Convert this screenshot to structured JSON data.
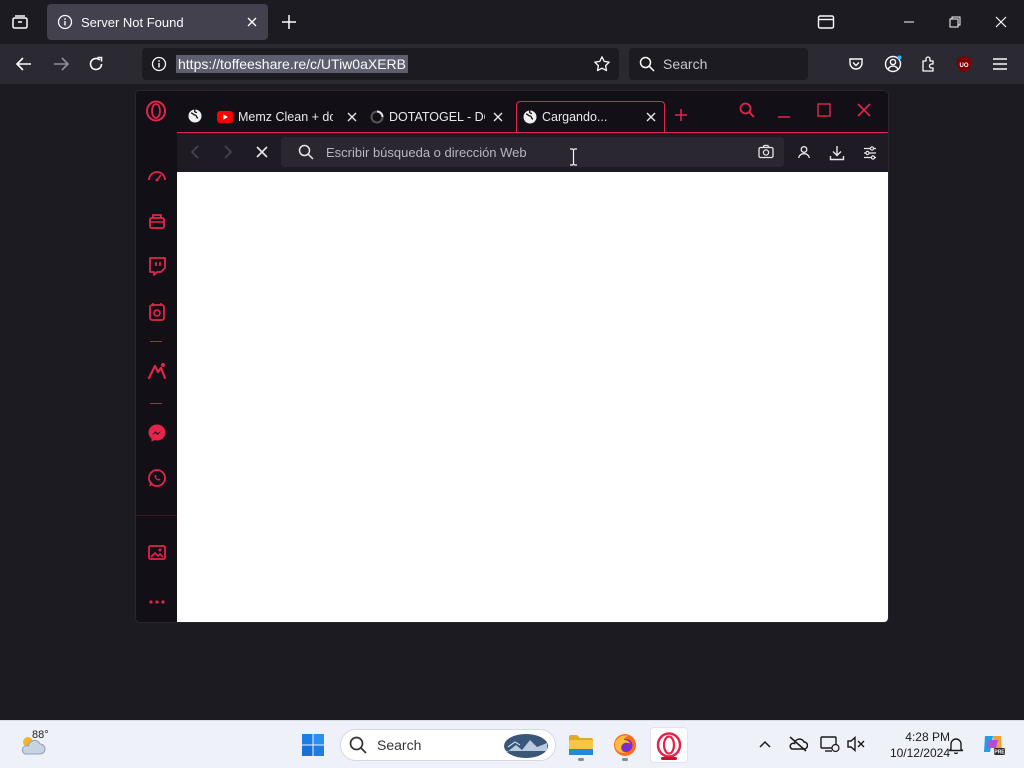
{
  "firefox": {
    "tab": {
      "title": "Server Not Found",
      "icon": "info-icon"
    },
    "urlbar": {
      "url": "https://toffeeshare.re/c/UTiw0aXERB"
    },
    "search": {
      "placeholder": "Search"
    }
  },
  "opera": {
    "tabs": [
      {
        "title": "Memz Clean + do",
        "icon": "youtube-icon"
      },
      {
        "title": "DOTATOGEL - DOT",
        "icon": "spinner-icon"
      },
      {
        "title": "Cargando...",
        "icon": "globe-icon"
      }
    ],
    "address": {
      "placeholder": "Escribir búsqueda o dirección Web"
    },
    "accent": "#e4244a"
  },
  "taskbar": {
    "weather": {
      "temp": "88°"
    },
    "search": {
      "label": "Search"
    },
    "clock": {
      "time": "4:28 PM",
      "date": "10/12/2024"
    }
  }
}
